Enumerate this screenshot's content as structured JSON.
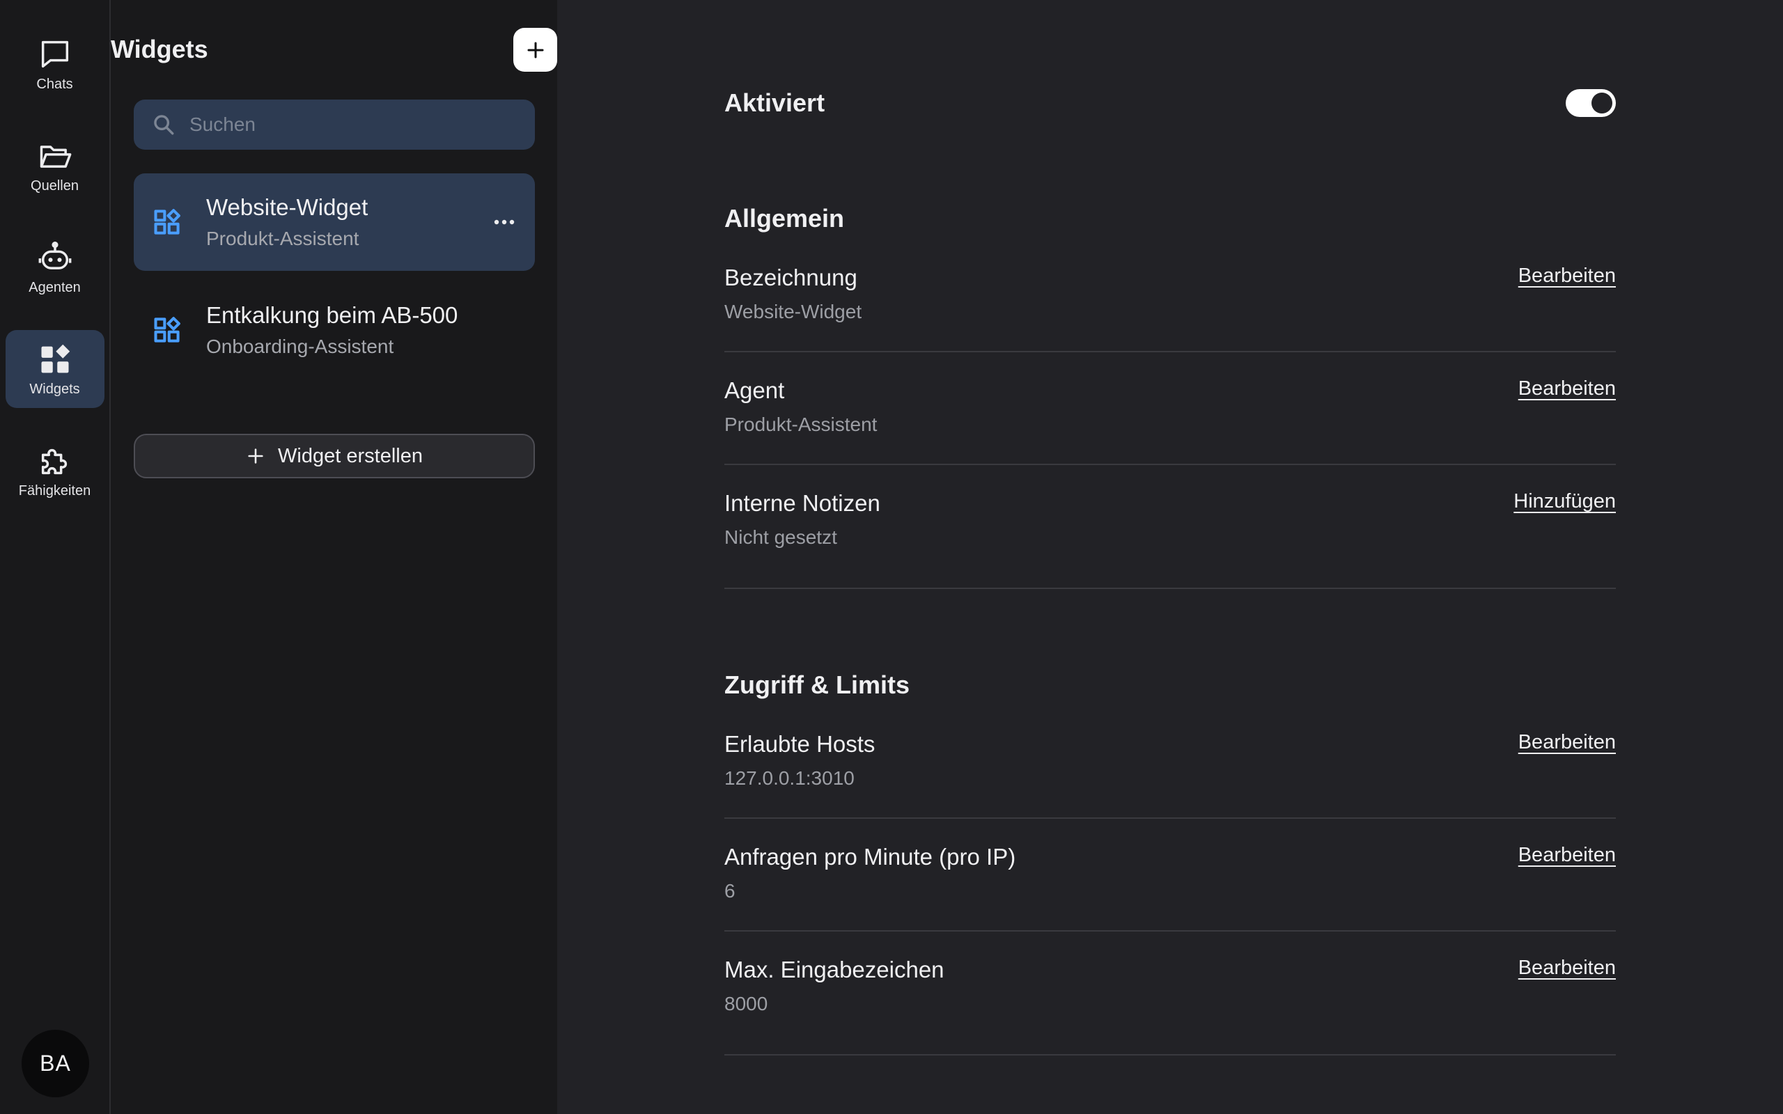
{
  "rail": {
    "items": [
      {
        "label": "Chats",
        "icon": "chat-bubble-icon"
      },
      {
        "label": "Quellen",
        "icon": "folder-open-icon"
      },
      {
        "label": "Agenten",
        "icon": "robot-icon"
      },
      {
        "label": "Widgets",
        "icon": "widgets-icon"
      },
      {
        "label": "Fähigkeiten",
        "icon": "puzzle-icon"
      }
    ],
    "avatar": "BA"
  },
  "panel": {
    "title": "Widgets",
    "search_placeholder": "Suchen",
    "items": [
      {
        "title": "Website-Widget",
        "subtitle": "Produkt-Assistent"
      },
      {
        "title": "Entkalkung beim AB-500",
        "subtitle": "Onboarding-Assistent"
      }
    ],
    "create_label": "Widget erstellen"
  },
  "main": {
    "activated_label": "Aktiviert",
    "activated": true,
    "general": {
      "title": "Allgemein",
      "fields": [
        {
          "label": "Bezeichnung",
          "value": "Website-Widget",
          "action": "Bearbeiten"
        },
        {
          "label": "Agent",
          "value": "Produkt-Assistent",
          "action": "Bearbeiten"
        },
        {
          "label": "Interne Notizen",
          "value": "Nicht gesetzt",
          "action": "Hinzufügen"
        }
      ]
    },
    "access": {
      "title": "Zugriff & Limits",
      "fields": [
        {
          "label": "Erlaubte Hosts",
          "value": "127.0.0.1:3010",
          "action": "Bearbeiten"
        },
        {
          "label": "Anfragen pro Minute (pro IP)",
          "value": "6",
          "action": "Bearbeiten"
        },
        {
          "label": "Max. Eingabezeichen",
          "value": "8000",
          "action": "Bearbeiten"
        }
      ]
    }
  },
  "colors": {
    "accent_icon": "#4a9eff",
    "active_bg": "#2d3b52",
    "panel_bg": "#19191b",
    "main_bg": "#222226"
  }
}
